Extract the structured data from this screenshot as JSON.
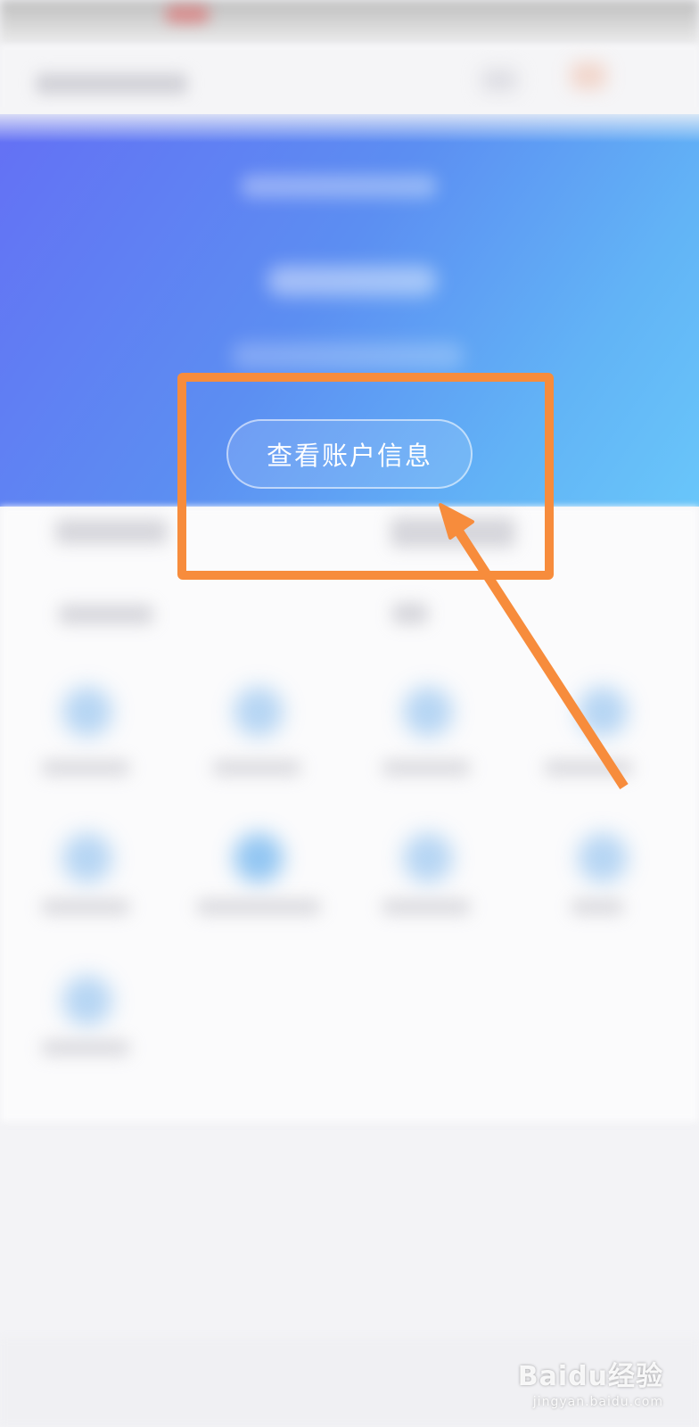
{
  "header": {
    "account_info_button_label": "查看账户信息"
  },
  "annotations": {
    "highlight_color": "#f78c3c",
    "arrow_color": "#f78c3c"
  },
  "colors": {
    "banner_gradient": [
      "#6470f4",
      "#5c8ef2",
      "#62b4f6",
      "#69c6fa"
    ],
    "page_background": "#f3f3f6"
  },
  "watermark": {
    "logo": "Baidu经验",
    "url": "jingyan.baidu.com"
  }
}
